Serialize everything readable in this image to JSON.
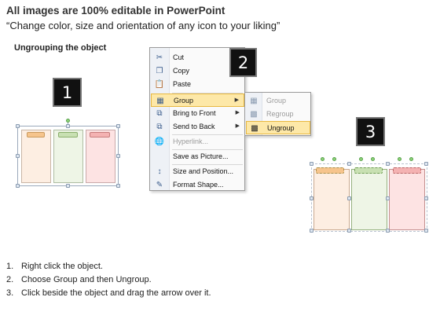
{
  "header": {
    "title": "All images are 100% editable in PowerPoint",
    "subtitle": "“Change color, size and orientation of any icon to your liking”"
  },
  "section_label": "Ungrouping the object",
  "badges": [
    "1",
    "2",
    "3"
  ],
  "context_menu": {
    "items": [
      {
        "label": "Cut",
        "icon": "scissors-icon"
      },
      {
        "label": "Copy",
        "icon": "copy-icon"
      },
      {
        "label": "Paste",
        "icon": "paste-icon"
      },
      {
        "label": "Group",
        "icon": "group-icon",
        "selected": true,
        "has_submenu": true
      },
      {
        "label": "Bring to Front",
        "icon": "bring-to-front-icon",
        "has_submenu": true
      },
      {
        "label": "Send to Back",
        "icon": "send-to-back-icon",
        "has_submenu": true
      },
      {
        "label": "Hyperlink...",
        "icon": "hyperlink-icon",
        "disabled": true
      },
      {
        "label": "Save as Picture...",
        "icon": ""
      },
      {
        "label": "Size and Position...",
        "icon": "size-position-icon"
      },
      {
        "label": "Format Shape...",
        "icon": "format-shape-icon"
      }
    ]
  },
  "submenu": {
    "items": [
      {
        "label": "Group",
        "icon": "group-icon",
        "disabled": true
      },
      {
        "label": "Regroup",
        "icon": "regroup-icon",
        "disabled": true
      },
      {
        "label": "Ungroup",
        "icon": "ungroup-icon",
        "selected": true
      }
    ]
  },
  "steps": [
    {
      "num": "1.",
      "text": "Right click the object."
    },
    {
      "num": "2.",
      "text": "Choose Group and then Ungroup."
    },
    {
      "num": "3.",
      "text": "Click beside the object and drag the arrow over it."
    }
  ],
  "colors": {
    "orange_fill": "#fdeee2",
    "green_fill": "#eef5e6",
    "red_fill": "#fde3e3",
    "highlight": "#fde8a8",
    "badge_bg": "#111111"
  }
}
